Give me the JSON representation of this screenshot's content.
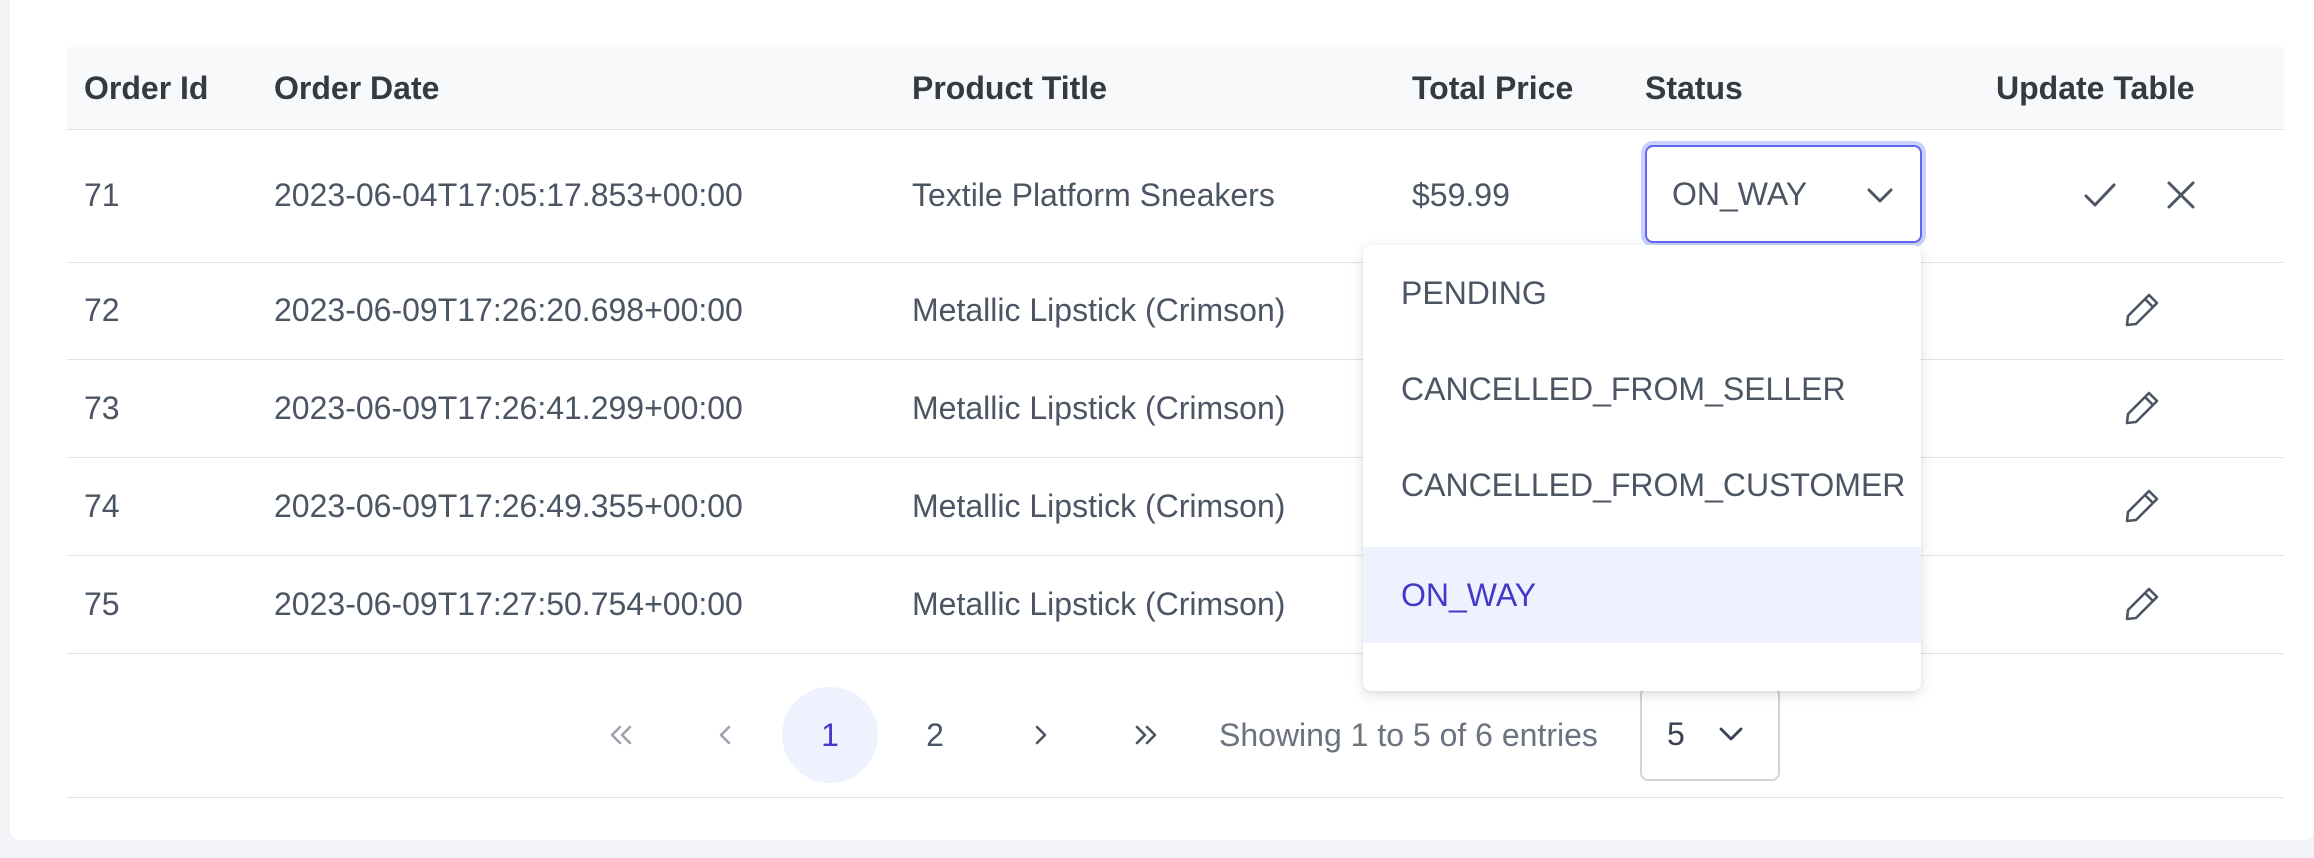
{
  "table": {
    "headers": {
      "order_id": "Order Id",
      "order_date": "Order Date",
      "product_title": "Product Title",
      "total_price": "Total Price",
      "status": "Status",
      "update_table": "Update Table"
    },
    "editing_row": {
      "order_id": "71",
      "order_date": "2023-06-04T17:05:17.853+00:00",
      "product_title": "Textile Platform Sneakers",
      "total_price": "$59.99",
      "status_value": "ON_WAY",
      "save_icon": "check-icon",
      "cancel_icon": "close-icon"
    },
    "rows": [
      {
        "order_id": "72",
        "order_date": "2023-06-09T17:26:20.698+00:00",
        "product_title": "Metallic Lipstick (Crimson)",
        "edit_icon": "pencil-icon"
      },
      {
        "order_id": "73",
        "order_date": "2023-06-09T17:26:41.299+00:00",
        "product_title": "Metallic Lipstick (Crimson)",
        "edit_icon": "pencil-icon"
      },
      {
        "order_id": "74",
        "order_date": "2023-06-09T17:26:49.355+00:00",
        "product_title": "Metallic Lipstick (Crimson)",
        "edit_icon": "pencil-icon"
      },
      {
        "order_id": "75",
        "order_date": "2023-06-09T17:27:50.754+00:00",
        "product_title": "Metallic Lipstick (Crimson)",
        "edit_icon": "pencil-icon"
      }
    ]
  },
  "status_dropdown": {
    "options": [
      "PENDING",
      "CANCELLED_FROM_SELLER",
      "CANCELLED_FROM_CUSTOMER",
      "ON_WAY"
    ],
    "selected": "ON_WAY"
  },
  "pagination": {
    "first_icon": "chevrons-left-icon",
    "prev_icon": "chevron-left-icon",
    "pages": [
      "1",
      "2"
    ],
    "current_page": "1",
    "next_icon": "chevron-right-icon",
    "last_icon": "chevrons-right-icon",
    "info": "Showing 1 to 5 of 6 entries",
    "rows_per_page": "5"
  },
  "colors": {
    "accent": "#4338ca",
    "accent_bg": "#eef2ff",
    "focus_border": "#6366f1",
    "header_bg": "#f8f9fa",
    "border": "#dee2e6"
  }
}
